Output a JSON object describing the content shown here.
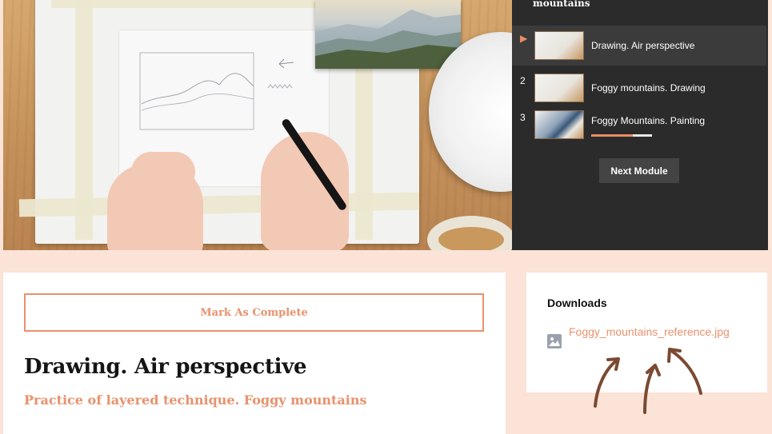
{
  "playlist": {
    "title": "mountains",
    "items": [
      {
        "marker": "▶",
        "label": "Drawing. Air perspective",
        "active": true
      },
      {
        "number": "2",
        "label": "Foggy mountains. Drawing"
      },
      {
        "number": "3",
        "label": "Foggy Mountains. Painting",
        "progress": 0.68
      }
    ],
    "next_button": "Next Module"
  },
  "lesson": {
    "complete_button": "Mark As Complete",
    "title": "Drawing. Air perspective",
    "subtitle": "Practice of layered technique. Foggy mountains"
  },
  "downloads": {
    "title": "Downloads",
    "file_name": "Foggy_mountains_reference.jpg",
    "icon": "image-file-icon"
  },
  "colors": {
    "accent": "#e8926d",
    "panel_dark": "#2b2b2b",
    "page_bg": "#fbe3d7",
    "arrow": "#7a4a32"
  }
}
